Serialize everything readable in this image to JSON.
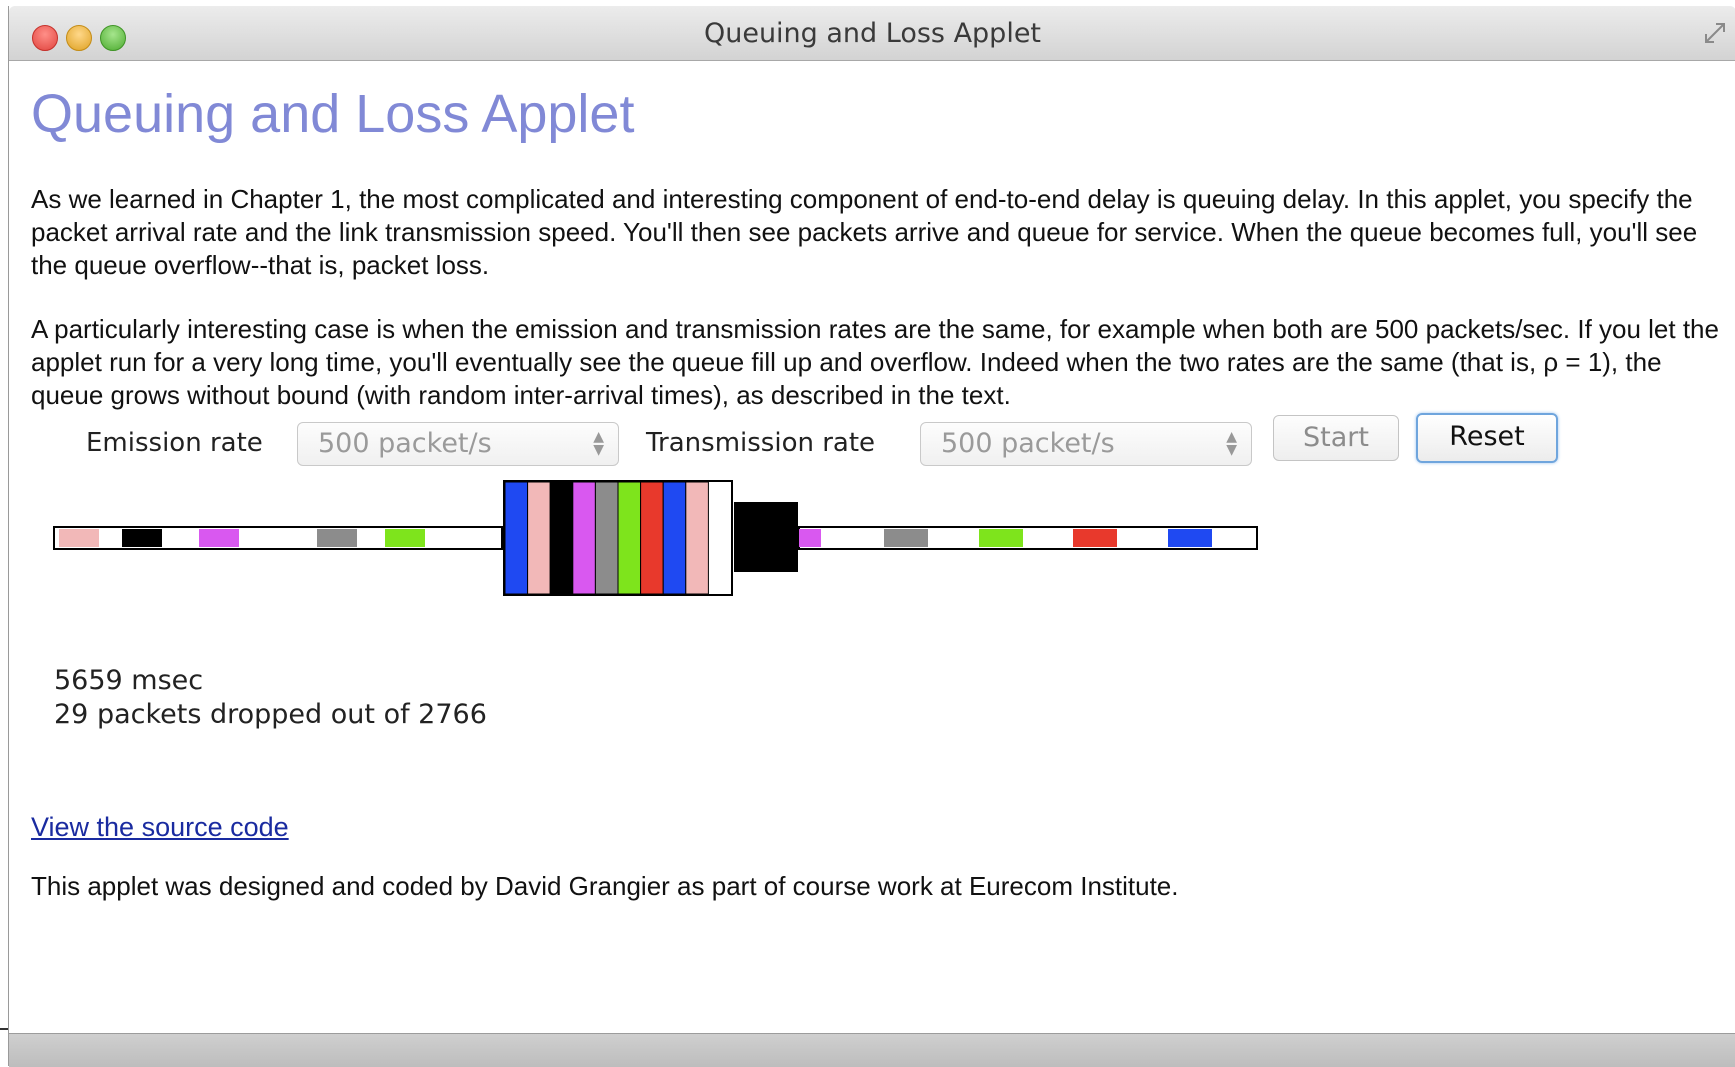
{
  "window": {
    "title": "Queuing and Loss Applet"
  },
  "page": {
    "heading": "Queuing and Loss Applet",
    "paragraphs": [
      "As we learned in Chapter 1, the most complicated and interesting component of end-to-end delay is queuing delay. In this applet, you specify the packet arrival rate and the link transmission speed. You'll then see packets arrive and queue for service. When the queue becomes full, you'll see the queue overflow--that is, packet loss.",
      "A particularly interesting case is when the emission and transmission rates are the same, for example when both are 500 packets/sec. If you let the applet run for a very long time, you'll eventually see the queue fill up and overflow. Indeed when the two rates are the same (that is, ρ = 1), the queue grows without bound (with random inter-arrival times), as described in the text."
    ],
    "source_link": "View the source code",
    "credit": "This applet was designed and coded by David Grangier as part of course work at Eurecom Institute."
  },
  "controls": {
    "emission_label": "Emission rate",
    "emission_value": "500  packet/s",
    "transmission_label": "Transmission rate",
    "transmission_value": "500  packet/s",
    "start_label": "Start",
    "reset_label": "Reset"
  },
  "simulation": {
    "time_text": "5659 msec",
    "dropped_text": "29 packets dropped out of 2766",
    "incoming_packets": [
      "#f2b8b8",
      "#000000",
      "#d958f0",
      "#8c8c8c",
      "#7ee41c"
    ],
    "queued_packets": [
      "#1f49f2",
      "#f2b8b8",
      "#000000",
      "#d958f0",
      "#8c8c8c",
      "#7ee41c",
      "#e8392c",
      "#1f49f2",
      "#f2b8b8"
    ],
    "outgoing_packets": [
      "#d958f0",
      "#8c8c8c",
      "#7ee41c",
      "#e8392c",
      "#1f49f2"
    ],
    "transmitting_color": "#000000"
  }
}
